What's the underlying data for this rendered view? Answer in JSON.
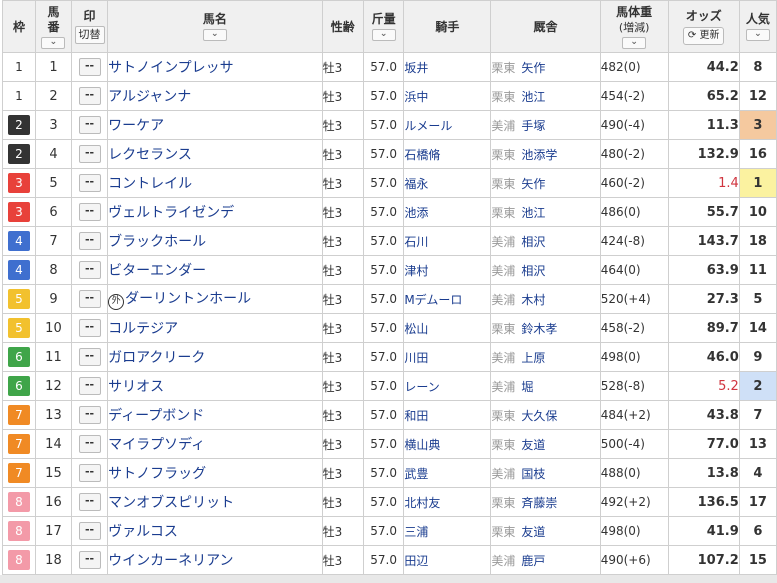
{
  "headers": {
    "waku": "枠",
    "umaban_1": "馬",
    "umaban_2": "番",
    "mark": "印",
    "mark_toggle": "切替",
    "horse": "馬名",
    "sexage": "性齢",
    "weight": "斤量",
    "jockey": "騎手",
    "trainer": "厩舎",
    "bodyweight": "馬体重",
    "bodyweight_sub": "(増減)",
    "odds": "オッズ",
    "reload": "更新",
    "popularity": "人気",
    "sort_glyph": "⌄"
  },
  "mark_blank": "--",
  "foreign_mark": "外",
  "waku_colors": {
    "1": {
      "bg": "#ffffff",
      "fg": "#333333"
    },
    "2": {
      "bg": "#333333",
      "fg": "#ffffff"
    },
    "3": {
      "bg": "#e8413a",
      "fg": "#ffffff"
    },
    "4": {
      "bg": "#3f6fcf",
      "fg": "#ffffff"
    },
    "5": {
      "bg": "#f2c12e",
      "fg": "#ffffff"
    },
    "6": {
      "bg": "#3fa549",
      "fg": "#ffffff"
    },
    "7": {
      "bg": "#f08a24",
      "fg": "#ffffff"
    },
    "8": {
      "bg": "#f39aa8",
      "fg": "#ffffff"
    }
  },
  "rows": [
    {
      "waku": "1",
      "umaban": "1",
      "horse": "サトノインプレッサ",
      "foreign": false,
      "sexage": "牡3",
      "weight": "57.0",
      "jockey": "坂井",
      "area": "栗東",
      "trainer": "矢作",
      "bodyweight": "482(0)",
      "odds": "44.2",
      "odds_red": false,
      "pop": "8",
      "pop_hl": ""
    },
    {
      "waku": "1",
      "umaban": "2",
      "horse": "アルジャンナ",
      "foreign": false,
      "sexage": "牡3",
      "weight": "57.0",
      "jockey": "浜中",
      "area": "栗東",
      "trainer": "池江",
      "bodyweight": "454(-2)",
      "odds": "65.2",
      "odds_red": false,
      "pop": "12",
      "pop_hl": ""
    },
    {
      "waku": "2",
      "umaban": "3",
      "horse": "ワーケア",
      "foreign": false,
      "sexage": "牡3",
      "weight": "57.0",
      "jockey": "ルメール",
      "area": "美浦",
      "trainer": "手塚",
      "bodyweight": "490(-4)",
      "odds": "11.3",
      "odds_red": false,
      "pop": "3",
      "pop_hl": "p3"
    },
    {
      "waku": "2",
      "umaban": "4",
      "horse": "レクセランス",
      "foreign": false,
      "sexage": "牡3",
      "weight": "57.0",
      "jockey": "石橋脩",
      "area": "栗東",
      "trainer": "池添学",
      "bodyweight": "480(-2)",
      "odds": "132.9",
      "odds_red": false,
      "pop": "16",
      "pop_hl": ""
    },
    {
      "waku": "3",
      "umaban": "5",
      "horse": "コントレイル",
      "foreign": false,
      "sexage": "牡3",
      "weight": "57.0",
      "jockey": "福永",
      "area": "栗東",
      "trainer": "矢作",
      "bodyweight": "460(-2)",
      "odds": "1.4",
      "odds_red": true,
      "pop": "1",
      "pop_hl": "p1"
    },
    {
      "waku": "3",
      "umaban": "6",
      "horse": "ヴェルトライゼンデ",
      "foreign": false,
      "sexage": "牡3",
      "weight": "57.0",
      "jockey": "池添",
      "area": "栗東",
      "trainer": "池江",
      "bodyweight": "486(0)",
      "odds": "55.7",
      "odds_red": false,
      "pop": "10",
      "pop_hl": ""
    },
    {
      "waku": "4",
      "umaban": "7",
      "horse": "ブラックホール",
      "foreign": false,
      "sexage": "牡3",
      "weight": "57.0",
      "jockey": "石川",
      "area": "美浦",
      "trainer": "相沢",
      "bodyweight": "424(-8)",
      "odds": "143.7",
      "odds_red": false,
      "pop": "18",
      "pop_hl": ""
    },
    {
      "waku": "4",
      "umaban": "8",
      "horse": "ビターエンダー",
      "foreign": false,
      "sexage": "牡3",
      "weight": "57.0",
      "jockey": "津村",
      "area": "美浦",
      "trainer": "相沢",
      "bodyweight": "464(0)",
      "odds": "63.9",
      "odds_red": false,
      "pop": "11",
      "pop_hl": ""
    },
    {
      "waku": "5",
      "umaban": "9",
      "horse": "ダーリントンホール",
      "foreign": true,
      "sexage": "牡3",
      "weight": "57.0",
      "jockey": "Mデムーロ",
      "area": "美浦",
      "trainer": "木村",
      "bodyweight": "520(+4)",
      "odds": "27.3",
      "odds_red": false,
      "pop": "5",
      "pop_hl": ""
    },
    {
      "waku": "5",
      "umaban": "10",
      "horse": "コルテジア",
      "foreign": false,
      "sexage": "牡3",
      "weight": "57.0",
      "jockey": "松山",
      "area": "栗東",
      "trainer": "鈴木孝",
      "bodyweight": "458(-2)",
      "odds": "89.7",
      "odds_red": false,
      "pop": "14",
      "pop_hl": ""
    },
    {
      "waku": "6",
      "umaban": "11",
      "horse": "ガロアクリーク",
      "foreign": false,
      "sexage": "牡3",
      "weight": "57.0",
      "jockey": "川田",
      "area": "美浦",
      "trainer": "上原",
      "bodyweight": "498(0)",
      "odds": "46.0",
      "odds_red": false,
      "pop": "9",
      "pop_hl": ""
    },
    {
      "waku": "6",
      "umaban": "12",
      "horse": "サリオス",
      "foreign": false,
      "sexage": "牡3",
      "weight": "57.0",
      "jockey": "レーン",
      "area": "美浦",
      "trainer": "堀",
      "bodyweight": "528(-8)",
      "odds": "5.2",
      "odds_red": true,
      "pop": "2",
      "pop_hl": "p2"
    },
    {
      "waku": "7",
      "umaban": "13",
      "horse": "ディープボンド",
      "foreign": false,
      "sexage": "牡3",
      "weight": "57.0",
      "jockey": "和田",
      "area": "栗東",
      "trainer": "大久保",
      "bodyweight": "484(+2)",
      "odds": "43.8",
      "odds_red": false,
      "pop": "7",
      "pop_hl": ""
    },
    {
      "waku": "7",
      "umaban": "14",
      "horse": "マイラプソディ",
      "foreign": false,
      "sexage": "牡3",
      "weight": "57.0",
      "jockey": "横山典",
      "area": "栗東",
      "trainer": "友道",
      "bodyweight": "500(-4)",
      "odds": "77.0",
      "odds_red": false,
      "pop": "13",
      "pop_hl": ""
    },
    {
      "waku": "7",
      "umaban": "15",
      "horse": "サトノフラッグ",
      "foreign": false,
      "sexage": "牡3",
      "weight": "57.0",
      "jockey": "武豊",
      "area": "美浦",
      "trainer": "国枝",
      "bodyweight": "488(0)",
      "odds": "13.8",
      "odds_red": false,
      "pop": "4",
      "pop_hl": ""
    },
    {
      "waku": "8",
      "umaban": "16",
      "horse": "マンオブスピリット",
      "foreign": false,
      "sexage": "牡3",
      "weight": "57.0",
      "jockey": "北村友",
      "area": "栗東",
      "trainer": "斉藤崇",
      "bodyweight": "492(+2)",
      "odds": "136.5",
      "odds_red": false,
      "pop": "17",
      "pop_hl": ""
    },
    {
      "waku": "8",
      "umaban": "17",
      "horse": "ヴァルコス",
      "foreign": false,
      "sexage": "牡3",
      "weight": "57.0",
      "jockey": "三浦",
      "area": "栗東",
      "trainer": "友道",
      "bodyweight": "498(0)",
      "odds": "41.9",
      "odds_red": false,
      "pop": "6",
      "pop_hl": ""
    },
    {
      "waku": "8",
      "umaban": "18",
      "horse": "ウインカーネリアン",
      "foreign": false,
      "sexage": "牡3",
      "weight": "57.0",
      "jockey": "田辺",
      "area": "美浦",
      "trainer": "鹿戸",
      "bodyweight": "490(+6)",
      "odds": "107.2",
      "odds_red": false,
      "pop": "15",
      "pop_hl": ""
    }
  ]
}
